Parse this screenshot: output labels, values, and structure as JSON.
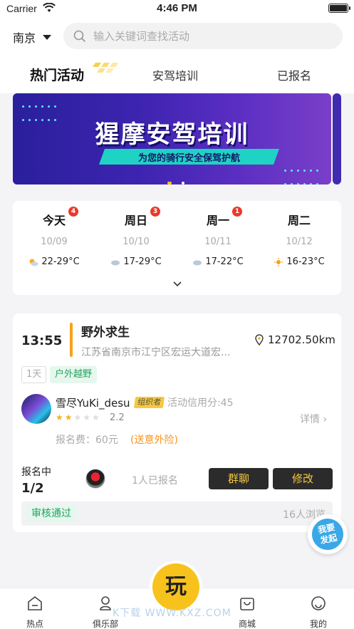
{
  "status_bar": {
    "carrier": "Carrier",
    "time": "4:46 PM"
  },
  "header": {
    "city": "南京",
    "search_placeholder": "输入关键词查找活动"
  },
  "tabs": [
    {
      "label": "热门活动",
      "active": true
    },
    {
      "label": "安驾培训",
      "active": false
    },
    {
      "label": "已报名",
      "active": false
    }
  ],
  "banner": {
    "title": "猩摩安驾培训",
    "subtitle": "为您的骑行安全保驾护航"
  },
  "days": [
    {
      "name": "今天",
      "badge": "4",
      "date": "10/09",
      "weather": "22-29°C",
      "icon": "partly-cloudy-icon"
    },
    {
      "name": "周日",
      "badge": "3",
      "date": "10/10",
      "weather": "17-29°C",
      "icon": "cloudy-icon"
    },
    {
      "name": "周一",
      "badge": "1",
      "date": "10/11",
      "weather": "17-22°C",
      "icon": "cloudy-icon"
    },
    {
      "name": "周二",
      "badge": "",
      "date": "10/12",
      "weather": "16-23°C",
      "icon": "sunny-icon"
    }
  ],
  "activity": {
    "time": "13:55",
    "title": "野外求生",
    "address": "江苏省南京市江宁区宏运大道宏...",
    "distance": "12702.50km",
    "tag_days": "1天",
    "tag_type": "户外越野",
    "organizer": {
      "name": "雪尽YuKi_desu",
      "role": "组织者",
      "credit": "活动信用分:45",
      "rating": 2.2,
      "rating_text": "2.2"
    },
    "details_label": "详情 ›",
    "fee": "报名费：60元",
    "insurance": "(送意外险)",
    "status": "报名中",
    "count": "1/2",
    "signed": "1人已报名",
    "btn_group": "群聊",
    "btn_edit": "修改",
    "review": "审核通过",
    "views": "16人浏览"
  },
  "fab": {
    "line1": "我要",
    "line2": "发起"
  },
  "tabbar": [
    {
      "label": "热点",
      "icon": "home-icon"
    },
    {
      "label": "俱乐部",
      "icon": "club-icon"
    },
    {
      "label": "玩",
      "icon": "play-icon"
    },
    {
      "label": "商城",
      "icon": "shop-icon"
    },
    {
      "label": "我的",
      "icon": "profile-icon"
    }
  ],
  "watermark": "K下载 WWW.KXZ.COM",
  "colors": {
    "accent": "#f7c21b",
    "orange": "#f7a21b",
    "green": "#24a360",
    "badge": "#e83a2e",
    "dark_button": "#2b2b2b"
  }
}
